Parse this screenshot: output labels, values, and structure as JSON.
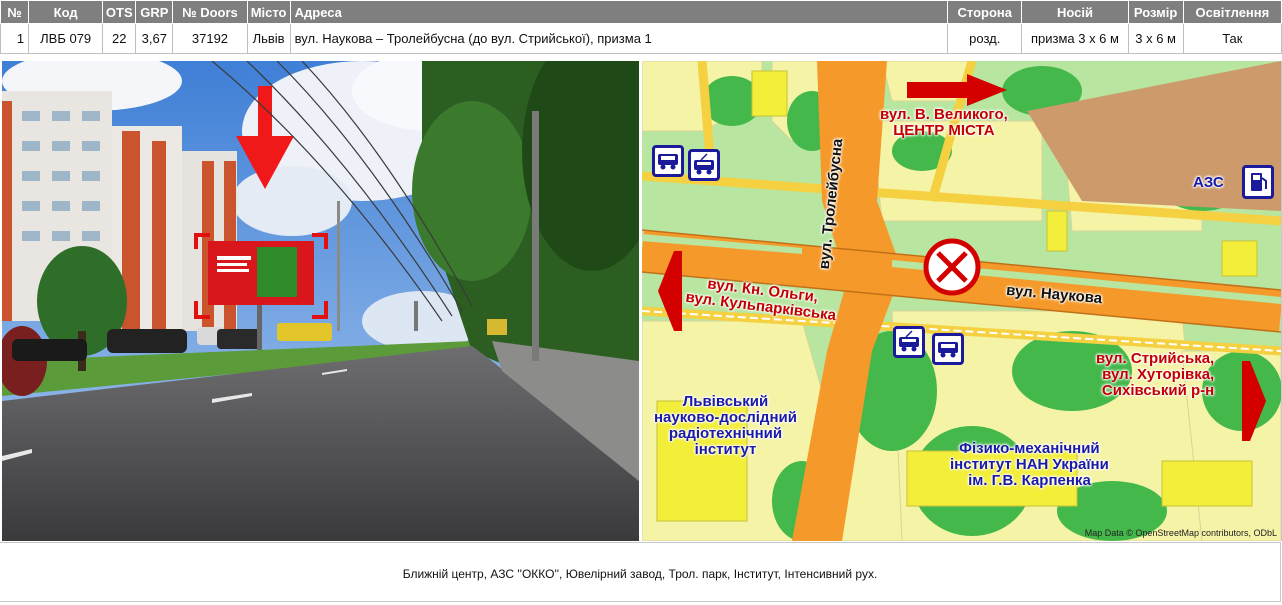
{
  "table": {
    "headers": {
      "num": "№",
      "code": "Код",
      "ots": "OTS",
      "grp": "GRP",
      "doors": "№ Doors",
      "city": "Місто",
      "address": "Адреса",
      "side": "Сторона",
      "carrier": "Носій",
      "size": "Розмір",
      "lighting": "Освітлення"
    },
    "row": {
      "num": "1",
      "code": "ЛВБ 079",
      "ots": "22",
      "grp": "3,67",
      "doors": "37192",
      "city": "Львів",
      "address": "вул. Наукова – Тролейбусна (до вул. Стрийської), призма 1",
      "side": "розд.",
      "carrier": "призма 3 х 6 м",
      "size": "3 х 6 м",
      "lighting": "Так"
    }
  },
  "map": {
    "labels": {
      "center": "вул. В. Великого,\nЦЕНТР МІСТА",
      "azs": "АЗС",
      "troleybusna": "вул. Тролейбусна",
      "naukova": "вул. Наукова",
      "olgy": "вул. Кн. Ольги,\nвул. Кульпарківська",
      "stryiska": "вул. Стрийська,\nвул. Хуторівка,\nСихівський р-н",
      "lviv_institute": "Львівський\nнауково-дослідний\nрадіотехнічний\nінститут",
      "fiz_institute": "Фізико-механічний\nінститут НАН України\nім. Г.В. Карпенка"
    },
    "credit": "Map Data © OpenStreetMap contributors, ODbL",
    "colors": {
      "road_main": "#f59a2a",
      "road_secondary": "#f5d040",
      "green": "#b8e6a0",
      "building": "#f5f3a6",
      "accent_red": "#d40000",
      "icon_blue": "#1a1a9a"
    }
  },
  "footer": {
    "text": "Ближній центр, АЗС ''ОККО'', Ювелірний завод, Трол. парк, Інститут, Інтенсивний рух."
  }
}
